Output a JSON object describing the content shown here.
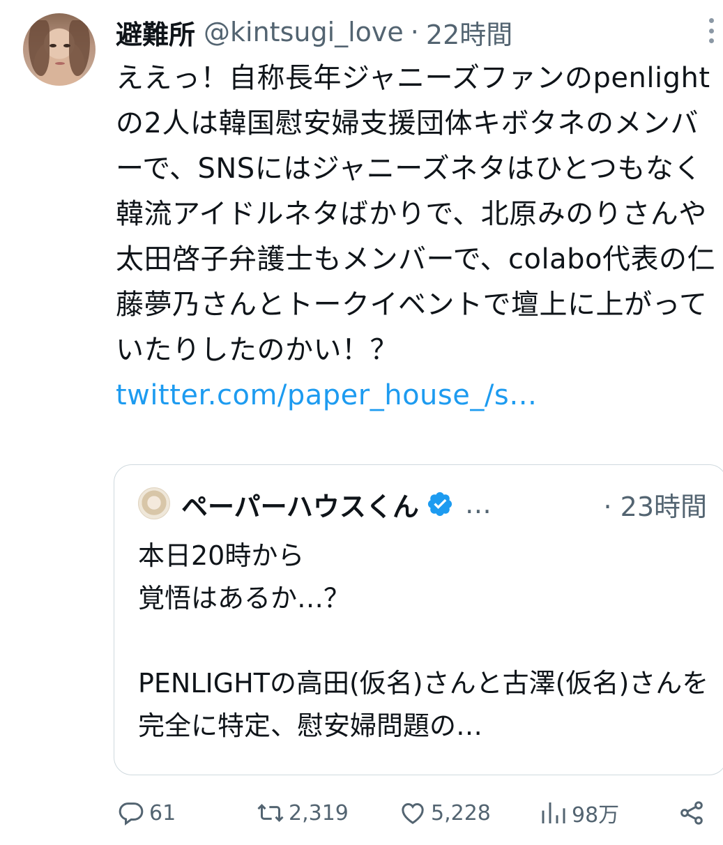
{
  "tweet": {
    "display_name": "避難所",
    "handle": "@kintsugi_love",
    "separator": "·",
    "time": "22時間",
    "text": "ええっ！自称長年ジャニーズファンのpenlightの2人は韓国慰安婦支援団体キボタネのメンバーで、SNSにはジャニーズネタはひとつもなく韓流アイドルネタばかりで、北原みのりさんや太田啓子弁護士もメンバーで、colabo代表の仁藤夢乃さんとトークイベントで壇上に上がっていたりしたのかい！？",
    "link": "twitter.com/paper_house_/s…"
  },
  "quote": {
    "display_name": "ペーパーハウスくん",
    "ellipsis": "…",
    "time": "· 23時間",
    "text": "本日20時から\n覚悟はあるか…？\n\nPENLIGHTの高田(仮名)さんと古澤(仮名)さんを完全に特定、慰安婦問題の…"
  },
  "actions": {
    "replies": "61",
    "retweets": "2,319",
    "likes": "5,228",
    "views": "98万"
  },
  "icons": [
    "avatar",
    "more-icon",
    "verified-icon",
    "reply-icon",
    "retweet-icon",
    "like-icon",
    "views-icon",
    "share-icon"
  ],
  "colors": {
    "link": "#1d9bf0",
    "secondary_text": "#536471",
    "border": "#cfd9de",
    "verified": "#1d9bf0"
  }
}
